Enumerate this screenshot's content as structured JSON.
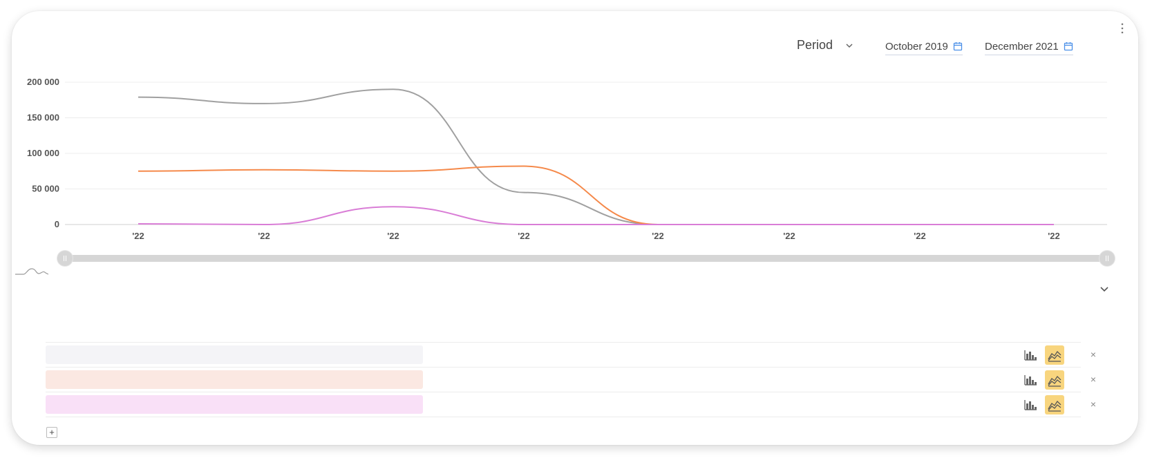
{
  "header": {
    "period_label": "Period",
    "date_from": "October 2019",
    "date_to": "December 2021"
  },
  "icons": {
    "menu": "kebab-icon",
    "period_toggle": "chevron-down-icon",
    "calendar": "calendar-icon",
    "collapse": "chevron-down-icon",
    "smoothing": "smooth-curve-icon",
    "bar_type": "bar-chart-icon",
    "area_type": "area-chart-icon",
    "remove": "close-icon",
    "add": "plus-icon"
  },
  "series_rows": [
    {
      "value": "",
      "bg_color": "#f4f4f7"
    },
    {
      "value": "",
      "bg_color": "#fbe8e2"
    },
    {
      "value": "",
      "bg_color": "#f9e0f7"
    }
  ],
  "remove_label": "×",
  "add_label": "+",
  "chart_data": {
    "type": "line",
    "title": "",
    "xlabel": "",
    "ylabel": "",
    "x": [
      0,
      1,
      2,
      3,
      4,
      5,
      6,
      7
    ],
    "x_tick_labels": [
      "'22",
      "'22",
      "'22",
      "'22",
      "'22",
      "'22",
      "'22",
      "'22"
    ],
    "ylim": [
      0,
      200000
    ],
    "y_ticks": [
      0,
      50000,
      100000,
      150000,
      200000
    ],
    "y_tick_labels": [
      "0",
      "50 000",
      "100 000",
      "150 000",
      "200 000"
    ],
    "grid": true,
    "series": [
      {
        "color": "#a0a0a0",
        "values": [
          179000,
          170000,
          190000,
          45000,
          0,
          0,
          0,
          0
        ]
      },
      {
        "color": "#f5894a",
        "values": [
          75000,
          77000,
          75000,
          82000,
          0,
          0,
          0,
          0
        ]
      },
      {
        "color": "#d97dd6",
        "values": [
          1000,
          0,
          25000,
          0,
          0,
          0,
          0,
          0
        ]
      }
    ]
  }
}
